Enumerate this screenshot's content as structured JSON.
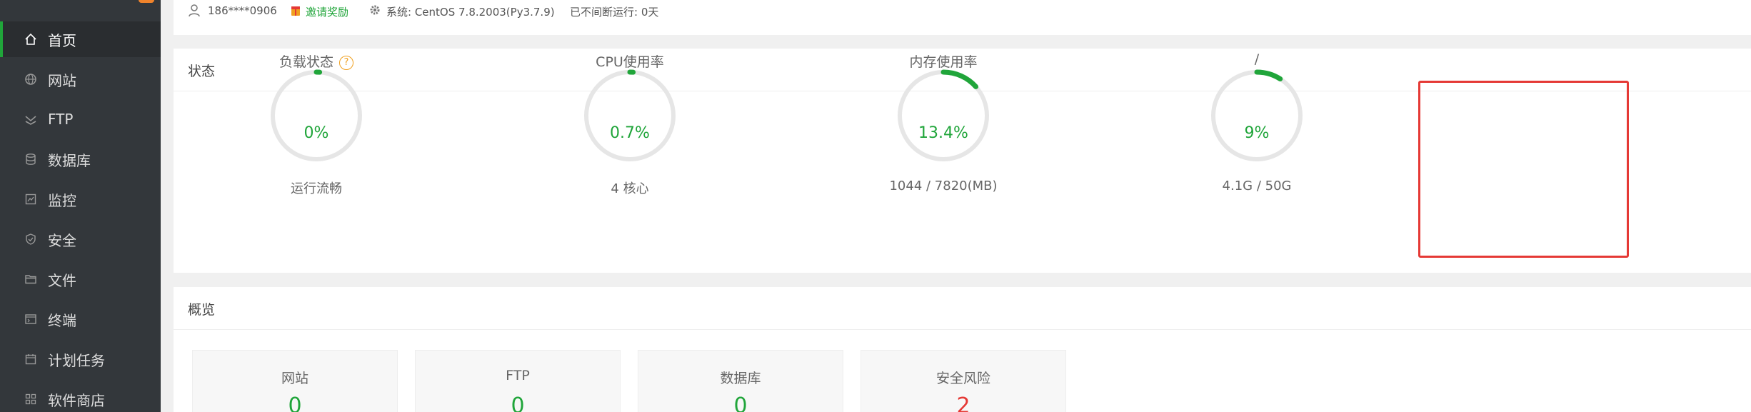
{
  "sidebar": {
    "brand": "",
    "brand_badge": "",
    "items": [
      {
        "label": "首页",
        "icon": "home-icon",
        "active": true
      },
      {
        "label": "网站",
        "icon": "globe-icon"
      },
      {
        "label": "FTP",
        "icon": "ftp-icon"
      },
      {
        "label": "数据库",
        "icon": "database-icon"
      },
      {
        "label": "监控",
        "icon": "monitor-icon"
      },
      {
        "label": "安全",
        "icon": "shield-icon"
      },
      {
        "label": "文件",
        "icon": "folder-icon"
      },
      {
        "label": "终端",
        "icon": "terminal-icon"
      },
      {
        "label": "计划任务",
        "icon": "calendar-icon"
      },
      {
        "label": "软件商店",
        "icon": "grid-icon"
      }
    ]
  },
  "topbar": {
    "user": "186****0906",
    "invite": "邀请奖励",
    "system": "系统:  CentOS 7.8.2003(Py3.7.9)",
    "uptime": "已不间断运行: 0天"
  },
  "status": {
    "title": "状态",
    "gauges": [
      {
        "title": "负载状态",
        "value": "0%",
        "percent": 0,
        "sub": "运行流畅",
        "help": "?"
      },
      {
        "title": "CPU使用率",
        "value": "0.7%",
        "percent": 0.7,
        "sub": "4 核心"
      },
      {
        "title": "内存使用率",
        "value": "13.4%",
        "percent": 13.4,
        "sub": "1044 / 7820(MB)"
      },
      {
        "title": "/",
        "value": "9%",
        "percent": 9,
        "sub": "4.1G / 50G"
      }
    ]
  },
  "overview": {
    "title": "概览",
    "cards": [
      {
        "label": "网站",
        "value": "0"
      },
      {
        "label": "FTP",
        "value": "0"
      },
      {
        "label": "数据库",
        "value": "0"
      },
      {
        "label": "安全风险",
        "value": "2",
        "danger": true
      }
    ]
  },
  "colors": {
    "accent": "#20a53a",
    "danger": "#e53935",
    "sidebar": "#33373b",
    "warn": "#f0a020"
  }
}
